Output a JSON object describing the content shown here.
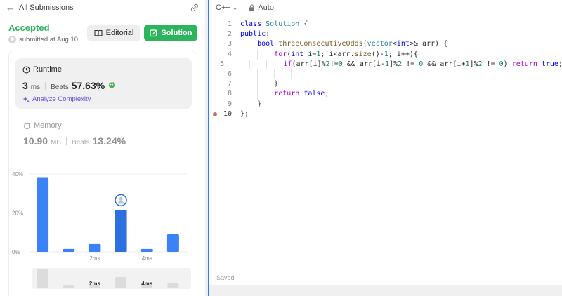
{
  "left": {
    "back_label": "All Submissions",
    "status": "Accepted",
    "submitted": "submitted at Aug 10,",
    "editorial_label": "Editorial",
    "solution_label": "Solution",
    "runtime": {
      "label": "Runtime",
      "value": "3",
      "unit": "ms",
      "beats_label": "Beats",
      "beats_value": "57.63%",
      "analyze_label": "Analyze Complexity"
    },
    "memory": {
      "label": "Memory",
      "value": "10.90",
      "unit": "MB",
      "beats_label": "Beats",
      "beats_value": "13.24%"
    }
  },
  "chart_data": {
    "type": "bar",
    "ylabel": "",
    "xlabel": "",
    "y_ticks": [
      "40%",
      "20%",
      "0%"
    ],
    "ylim": [
      0,
      40
    ],
    "x_tick_labels": [
      "2ms",
      "4ms"
    ],
    "bars": [
      {
        "x": "0ms",
        "value": 38,
        "highlight": false
      },
      {
        "x": "1ms",
        "value": 1.5,
        "highlight": false
      },
      {
        "x": "2ms",
        "value": 4,
        "highlight": false
      },
      {
        "x": "3ms",
        "value": 21.5,
        "highlight": true
      },
      {
        "x": "4ms",
        "value": 1.5,
        "highlight": false
      },
      {
        "x": "5ms",
        "value": 9,
        "highlight": false
      }
    ],
    "minimap_labels": [
      "2ms",
      "4ms"
    ],
    "colors": {
      "bar": "#3b82f6",
      "highlight": "#2b6fe0"
    }
  },
  "editor": {
    "language": "C++",
    "autosave": "Auto",
    "status": "Saved",
    "active_line": 10,
    "lines": [
      {
        "n": "1",
        "code": "class Solution {"
      },
      {
        "n": "2",
        "code": "public:"
      },
      {
        "n": "3",
        "code": "    bool threeConsecutiveOdds(vector<int>& arr) {"
      },
      {
        "n": "4",
        "code": "        for(int i=1; i<arr.size()-1; i++){"
      },
      {
        "n": "5",
        "code": "            if(arr[i]%2!=0 && arr[i-1]%2 != 0 && arr[i+1]%2 != 0) return true;"
      },
      {
        "n": "6",
        "code": ""
      },
      {
        "n": "7",
        "code": "        }"
      },
      {
        "n": "8",
        "code": "        return false;"
      },
      {
        "n": "9",
        "code": "    }"
      },
      {
        "n": "10",
        "code": "};"
      }
    ]
  }
}
